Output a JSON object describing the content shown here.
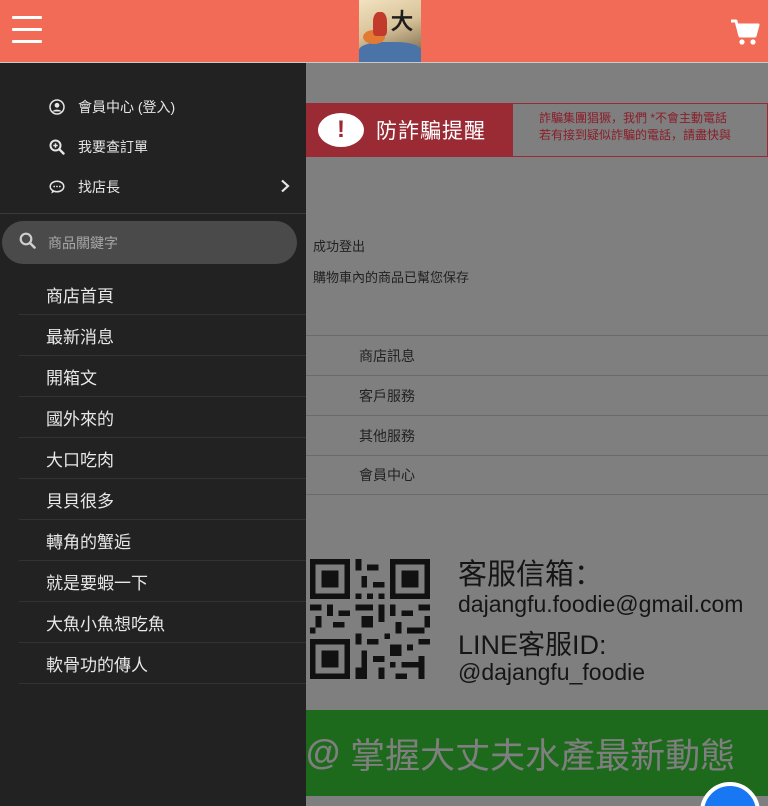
{
  "header": {
    "menu_icon": "hamburger-menu-icon",
    "logo_text": "大",
    "cart_icon": "shopping-cart-icon",
    "bg_color": "#f26b57"
  },
  "drawer": {
    "account_items": [
      {
        "icon": "user-circle-icon",
        "label": "會員中心 (登入)"
      },
      {
        "icon": "search-order-icon",
        "label": "我要查訂單"
      },
      {
        "icon": "chat-bubble-icon",
        "label": "找店長"
      }
    ],
    "search": {
      "placeholder": "商品關鍵字"
    },
    "categories": [
      "商店首頁",
      "最新消息",
      "開箱文",
      "國外來的",
      "大口吃肉",
      "貝貝很多",
      "轉角的蟹逅",
      "就是要蝦一下",
      "大魚小魚想吃魚",
      "軟骨功的傳人"
    ]
  },
  "content": {
    "fraud": {
      "title": "防詐騙提醒",
      "line1": "詐騙集團猖獗，我們 *不會主動電話",
      "line2": "若有接到疑似詐騙的電話，請盡快與"
    },
    "messages": [
      "成功登出",
      "購物車內的商品已幫您保存"
    ],
    "footer_links": [
      "商店訊息",
      "客戶服務",
      "其他服務",
      "會員中心"
    ],
    "contact": {
      "title": "客服信箱：",
      "email": "dajangfu.foodie@gmail.com",
      "line_label": "LINE客服ID:",
      "line_id": "@dajangfu_foodie"
    },
    "line_banner": {
      "at": "@",
      "text": "掌握大丈夫水產最新動態"
    }
  }
}
